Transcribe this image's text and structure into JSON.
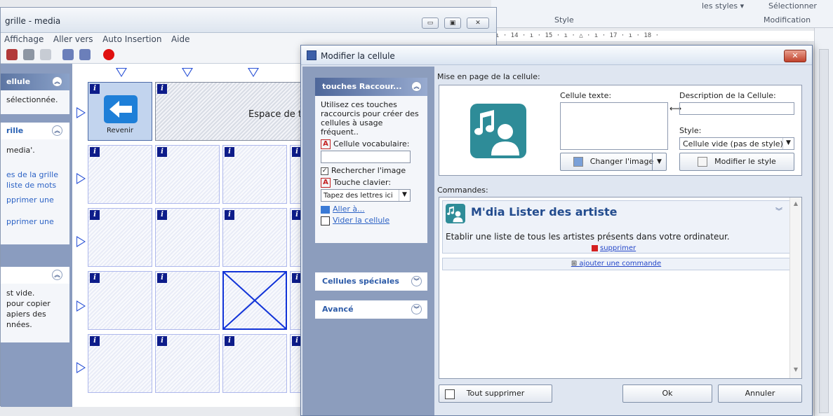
{
  "word": {
    "styles_link": "les styles ▾",
    "select_label": "Sélectionner",
    "style_group": "Style",
    "modification_group": "Modification",
    "ruler": "ı · 14 · ı · 15 · ı · △ · ı · 17 · ı · 18 ·"
  },
  "grid_window": {
    "title": "grille - media",
    "menu": [
      "Affichage",
      "Aller vers",
      "Auto Insertion",
      "Aide"
    ],
    "min_label": "▭",
    "max_label": "▣",
    "close_label": "✕"
  },
  "task_pane": {
    "cell_head": "ellule",
    "cell_text": "sélectionnée.",
    "grid_head": "rille",
    "grid_text": "media'.",
    "grid_links": [
      "es de la grille",
      "liste de mots",
      "pprimer une",
      "pprimer une"
    ],
    "third_text": [
      "st vide.",
      "pour copier",
      "apiers des",
      "nnées."
    ]
  },
  "grid": {
    "info_glyph": "i",
    "back_label": "Revenir",
    "space_label": "Espace de t"
  },
  "dialog": {
    "title": "Modifier la cellule",
    "close_label": "✕",
    "left": {
      "shortcuts_head": "touches Raccour...",
      "intro": "Utilisez ces touches raccourcis pour créer des cellules à usage fréquent..",
      "vocab_label": "Cellule vocabulaire:",
      "search_image": "Rechercher l'image",
      "key_label": "Touche clavier:",
      "key_placeholder": "Tapez des lettres ici",
      "goto": "Aller à...",
      "empty_cell": "Vider la cellule",
      "special_head": "Cellules spéciales",
      "advanced_head": "Avancé"
    },
    "layout_label": "Mise en page de la cellule:",
    "text_label": "Cellule texte:",
    "desc_label": "Description de la Cellule:",
    "style_label": "Style:",
    "style_value": "Cellule vide (pas de style)",
    "change_image": "Changer l'image",
    "modify_style": "Modifier le style",
    "commands_label": "Commandes:",
    "command": {
      "title": "M'dia Lister des artiste",
      "description": "Etablir une liste de tous les artistes présents dans votre ordinateur.",
      "delete": "supprimer"
    },
    "add_command": "ajouter une commande",
    "clear_all": "Tout supprimer",
    "ok": "Ok",
    "cancel": "Annuler"
  },
  "colors": {
    "accent_teal": "#2e8c98",
    "pane_blue": "#8c9dbd",
    "cell_border": "#1234d8",
    "close_red": "#c0412b"
  },
  "icons": [
    "arrow-left-icon",
    "music-person-icon",
    "info-icon",
    "record-icon",
    "chevron-up-icon",
    "chevron-down-icon",
    "picture-icon",
    "style-icon"
  ]
}
